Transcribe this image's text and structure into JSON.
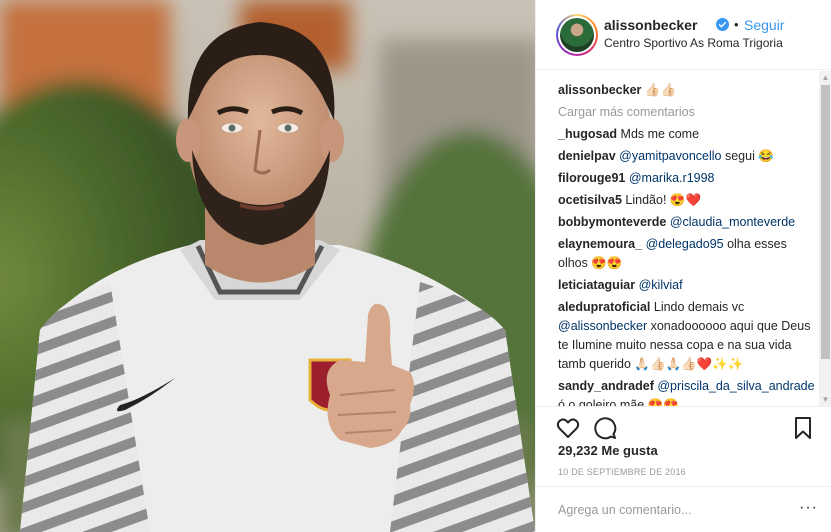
{
  "post": {
    "username": "alissonbecker",
    "follow_label": "Seguir",
    "separator": "•",
    "location": "Centro Sportivo As Roma Trigoria"
  },
  "caption": {
    "user": "alissonbecker",
    "text": "👍🏻👍🏻"
  },
  "load_more_label": "Cargar más comentarios",
  "comments": [
    {
      "user": "_hugosad",
      "parts": [
        {
          "t": "Mds me come"
        }
      ]
    },
    {
      "user": "denielpav",
      "parts": [
        {
          "m": "@yamitpavoncello"
        },
        {
          "t": " segui 😂"
        }
      ]
    },
    {
      "user": "filorouge91",
      "parts": [
        {
          "m": "@marika.r1998"
        }
      ]
    },
    {
      "user": "ocetisilva5",
      "parts": [
        {
          "t": "Lindão! 😍❤️"
        }
      ]
    },
    {
      "user": "bobbymonteverde",
      "parts": [
        {
          "m": "@claudia_monteverde"
        }
      ]
    },
    {
      "user": "elaynemoura_",
      "parts": [
        {
          "m": "@delegado95"
        },
        {
          "t": " olha esses olhos 😍😍"
        }
      ]
    },
    {
      "user": "leticiataguiar",
      "parts": [
        {
          "m": "@kilviaf"
        }
      ]
    },
    {
      "user": "aledupratoficial",
      "parts": [
        {
          "t": "Lindo demais vc "
        },
        {
          "m": "@alissonbecker"
        },
        {
          "t": " xonadoooooo aqui que Deus te Ilumine muito nessa copa e na sua vida tamb querido 🙏🏻👍🏻🙏🏻👍🏻❤️✨✨"
        }
      ]
    },
    {
      "user": "sandy_andradef",
      "parts": [
        {
          "m": "@priscila_da_silva_andrade"
        },
        {
          "t": " ó o goleiro mãe 😍😍"
        }
      ]
    }
  ],
  "likes_text": "29,232 Me gusta",
  "date_text": "10 DE SEPTIEMBRE DE 2016",
  "add_comment_placeholder": "Agrega un comentario...",
  "more_options": "···",
  "icons": {
    "like": "heart-icon",
    "comment": "comment-icon",
    "save": "bookmark-icon",
    "verified": "verified-badge-icon"
  },
  "colors": {
    "link": "#3897f0",
    "mention": "#003569",
    "muted": "#999999",
    "text": "#262626"
  }
}
